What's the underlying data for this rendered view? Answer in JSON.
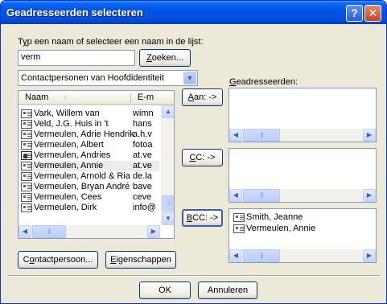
{
  "window": {
    "title": "Geadresseerden selecteren",
    "help_glyph": "?",
    "close_glyph": "✕"
  },
  "search": {
    "label_prefix": "T",
    "label_accel": "y",
    "label_rest": "p een naam of selecteer een naam in de lijst:",
    "value": "verm",
    "button_accel": "Z",
    "button_rest": "oeken..."
  },
  "address_book": {
    "selected": "Contactpersonen van Hoofdidentiteit"
  },
  "contacts": {
    "columns": {
      "name": "Naam",
      "email": "E-m"
    },
    "rows": [
      {
        "name": "Vark, Willem van",
        "email": "wimn",
        "icon": "contact-card-icon"
      },
      {
        "name": "Veld, J.G. Huis in 't",
        "email": "hans",
        "icon": "contact-card-icon"
      },
      {
        "name": "Vermeulen, Adrie Hendrik",
        "email": "a.h.v",
        "icon": "contact-card-icon"
      },
      {
        "name": "Vermeulen, Albert",
        "email": "fotoa",
        "icon": "contact-card-icon"
      },
      {
        "name": "Vermeulen, Andries",
        "email": "at.ve",
        "icon": "contact-group-icon"
      },
      {
        "name": "Vermeulen, Annie",
        "email": "at.ve",
        "icon": "contact-card-icon",
        "selected": true
      },
      {
        "name": "Vermeulen, Arnold & Ria",
        "email": "de.la",
        "icon": "contact-card-icon"
      },
      {
        "name": "Vermeulen, Bryan André",
        "email": "bave",
        "icon": "contact-card-icon"
      },
      {
        "name": "Vermeulen, Cees",
        "email": "ceve",
        "icon": "contact-card-icon"
      },
      {
        "name": "Vermeulen, Dirk",
        "email": "info@",
        "icon": "contact-card-icon"
      }
    ]
  },
  "buttons": {
    "contact_prefix": "C",
    "contact_accel": "o",
    "contact_rest": "ntactpersoon...",
    "props_accel": "E",
    "props_rest": "igenschappen",
    "to_accel": "A",
    "to_rest": "an: ->",
    "cc_accel": "C",
    "cc_rest": "C: ->",
    "bcc_accel": "B",
    "bcc_rest": "CC: ->",
    "ok": "OK",
    "cancel": "Annuleren"
  },
  "recipients": {
    "label_accel": "G",
    "label_rest": "eadresseerden:",
    "bcc": [
      "Smith, Jeanne",
      "Vermeulen, Annie"
    ]
  },
  "colors": {
    "title_bar": "#0054e3",
    "dialog_bg": "#ece9d8",
    "field_border": "#7f9db9"
  }
}
